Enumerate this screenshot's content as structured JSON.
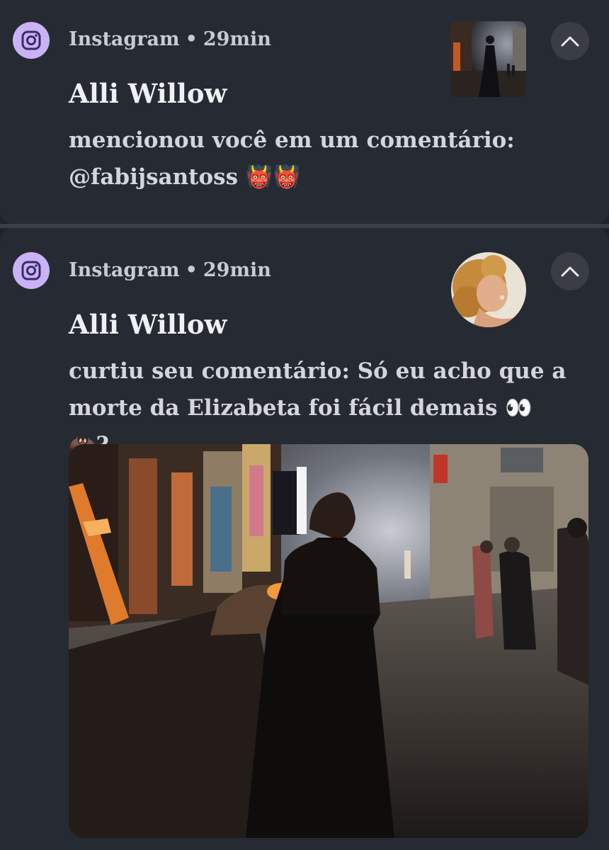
{
  "notifications": [
    {
      "app_name": "Instagram",
      "separator": "•",
      "time": "29min",
      "title": "Alli Willow",
      "body_line1": "mencionou você em um comentário:",
      "body_line2": "@fabijsantoss 👹👹",
      "collapse_icon": "chevron-up-icon",
      "thumbnail": "post-thumbnail-night-street"
    },
    {
      "app_name": "Instagram",
      "separator": "•",
      "time": "29min",
      "title": "Alli Willow",
      "body_line1": "curtiu seu comentário: Só eu acho que a",
      "body_line2": "morte da Elizabeta foi fácil demais 👀🦇?...",
      "collapse_icon": "chevron-up-icon",
      "avatar": "user-avatar-curly-hair",
      "image": "expanded-post-image-night-street-scene"
    }
  ],
  "colors": {
    "background": "#1f2229",
    "card": "#262a32",
    "instagram_icon_bg": "#c9b3f5",
    "instagram_icon_fg": "#3b2a66",
    "button_bg": "#3a3d45"
  }
}
